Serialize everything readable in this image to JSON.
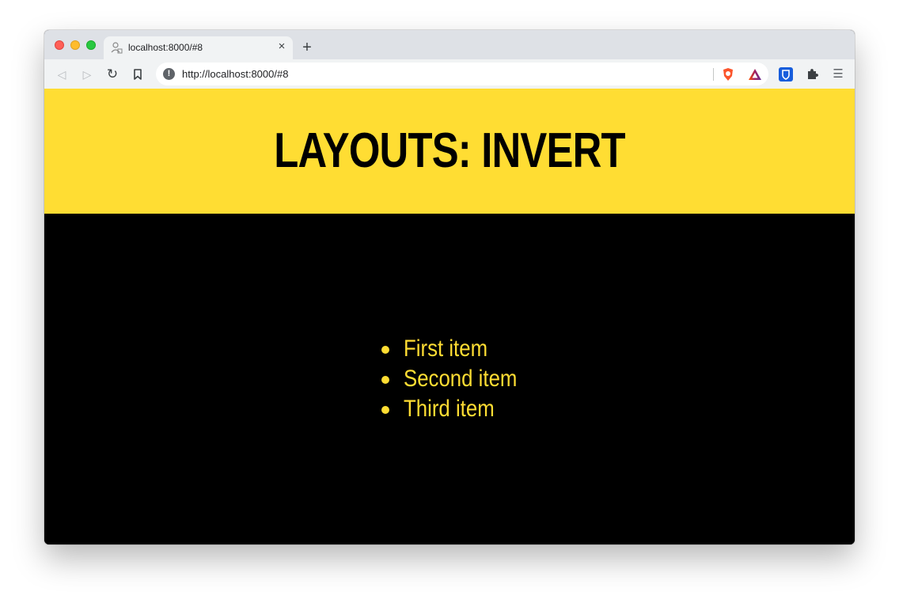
{
  "browser": {
    "tab": {
      "title": "localhost:8000/#8",
      "favicon": "user-agent-icon",
      "close": "×"
    },
    "new_tab": "+",
    "toolbar": {
      "back": "◁",
      "forward": "▷",
      "reload": "↻",
      "bookmark": "bookmark-icon",
      "url": "http://localhost:8000/#8",
      "site_info": "!"
    },
    "extensions": [
      "brave-shields-icon",
      "brave-rewards-icon",
      "bitwarden-icon",
      "extensions-puzzle-icon"
    ],
    "menu": "☰"
  },
  "page": {
    "title": "LAYOUTS: INVERT",
    "items": [
      "First item",
      "Second item",
      "Third item"
    ],
    "colors": {
      "accent": "#ffdd33",
      "background": "#000000",
      "title_text": "#000000"
    }
  }
}
